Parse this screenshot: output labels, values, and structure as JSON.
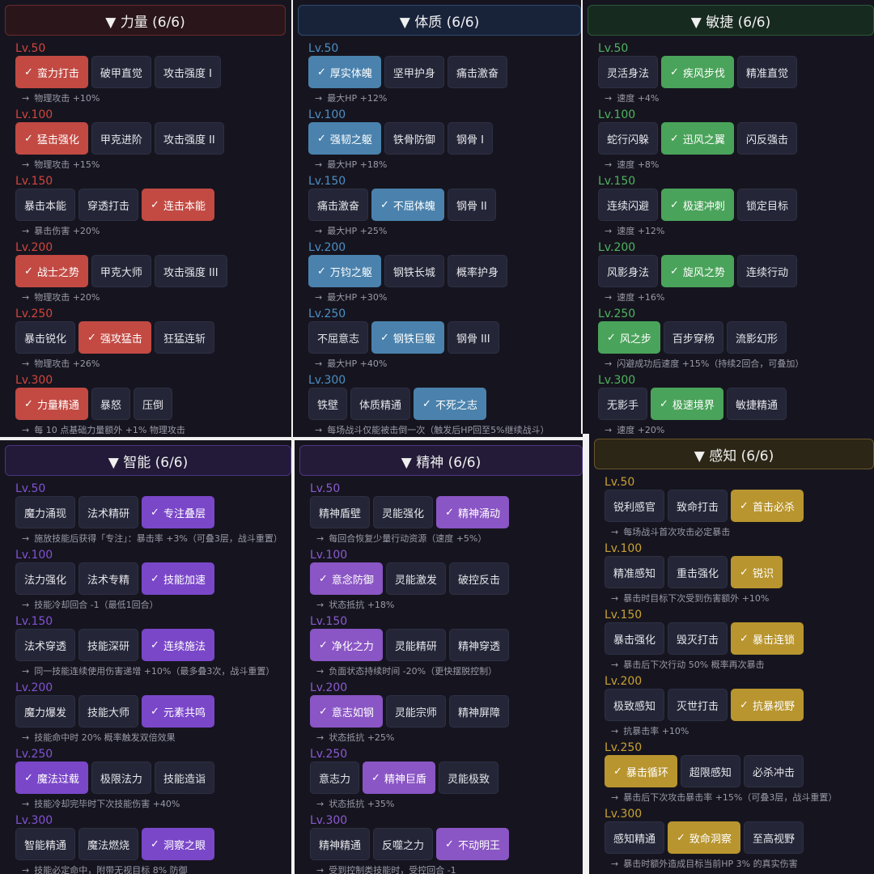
{
  "panels": [
    {
      "title": "▼ 力量 (6/6)",
      "accent": "#c24a43",
      "hdr_bg": "#2a161a",
      "hdr_border": "#6a2a2c",
      "level_color": "#d2453e",
      "levels": [
        {
          "label": "Lv.50",
          "skills": [
            "蛮力打击",
            "破甲直觉",
            "攻击强度 I"
          ],
          "selected": 0,
          "effect": "物理攻击 +10%"
        },
        {
          "label": "Lv.100",
          "skills": [
            "猛击强化",
            "甲克进阶",
            "攻击强度 II"
          ],
          "selected": 0,
          "effect": "物理攻击 +15%"
        },
        {
          "label": "Lv.150",
          "skills": [
            "暴击本能",
            "穿透打击",
            "连击本能"
          ],
          "selected": 2,
          "effect": "暴击伤害 +20%"
        },
        {
          "label": "Lv.200",
          "skills": [
            "战士之势",
            "甲克大师",
            "攻击强度 III"
          ],
          "selected": 0,
          "effect": "物理攻击 +20%"
        },
        {
          "label": "Lv.250",
          "skills": [
            "暴击锐化",
            "强攻猛击",
            "狂猛连斩"
          ],
          "selected": 1,
          "effect": "物理攻击 +26%"
        },
        {
          "label": "Lv.300",
          "skills": [
            "力量精通",
            "暴怒",
            "压倒"
          ],
          "selected": 0,
          "effect": "每 10 点基础力量额外 +1% 物理攻击"
        }
      ]
    },
    {
      "title": "▼ 体质 (6/6)",
      "accent": "#4a82ad",
      "hdr_bg": "#18233a",
      "hdr_border": "#2e4b70",
      "level_color": "#4d8fc4",
      "levels": [
        {
          "label": "Lv.50",
          "skills": [
            "厚实体魄",
            "坚甲护身",
            "痛击激奋"
          ],
          "selected": 0,
          "effect": "最大HP +12%"
        },
        {
          "label": "Lv.100",
          "skills": [
            "强韧之躯",
            "铁骨防御",
            "钢骨 I"
          ],
          "selected": 0,
          "effect": "最大HP +18%"
        },
        {
          "label": "Lv.150",
          "skills": [
            "痛击激奋",
            "不屈体魄",
            "钢骨 II"
          ],
          "selected": 1,
          "effect": "最大HP +25%"
        },
        {
          "label": "Lv.200",
          "skills": [
            "万钧之躯",
            "钢铁长城",
            "概率护身"
          ],
          "selected": 0,
          "effect": "最大HP +30%"
        },
        {
          "label": "Lv.250",
          "skills": [
            "不屈意志",
            "钢铁巨躯",
            "钢骨 III"
          ],
          "selected": 1,
          "effect": "最大HP +40%"
        },
        {
          "label": "Lv.300",
          "skills": [
            "铁壁",
            "体质精通",
            "不死之志"
          ],
          "selected": 2,
          "effect": "每场战斗仅能被击倒一次（触发后HP回至5%继续战斗）"
        }
      ]
    },
    {
      "title": "▼ 敏捷 (6/6)",
      "accent": "#4aa35a",
      "hdr_bg": "#172a20",
      "hdr_border": "#2a5a36",
      "level_color": "#4fb360",
      "levels": [
        {
          "label": "Lv.50",
          "skills": [
            "灵活身法",
            "疾风步伐",
            "精准直觉"
          ],
          "selected": 1,
          "effect": "速度 +4%"
        },
        {
          "label": "Lv.100",
          "skills": [
            "蛇行闪躲",
            "迅风之翼",
            "闪反强击"
          ],
          "selected": 1,
          "effect": "速度 +8%"
        },
        {
          "label": "Lv.150",
          "skills": [
            "连续闪避",
            "极速冲刺",
            "锁定目标"
          ],
          "selected": 1,
          "effect": "速度 +12%"
        },
        {
          "label": "Lv.200",
          "skills": [
            "风影身法",
            "旋风之势",
            "连续行动"
          ],
          "selected": 1,
          "effect": "速度 +16%"
        },
        {
          "label": "Lv.250",
          "skills": [
            "风之步",
            "百步穿杨",
            "流影幻形"
          ],
          "selected": 0,
          "effect": "闪避成功后速度 +15%（持续2回合，可叠加）"
        },
        {
          "label": "Lv.300",
          "skills": [
            "无影手",
            "极速境界",
            "敏捷精通"
          ],
          "selected": 1,
          "effect": "速度 +20%"
        }
      ]
    },
    {
      "title": "▼ 智能 (6/6)",
      "accent": "#7a47c9",
      "hdr_bg": "#221a38",
      "hdr_border": "#4a3480",
      "level_color": "#8152d4",
      "levels": [
        {
          "label": "Lv.50",
          "skills": [
            "魔力涌现",
            "法术精研",
            "专注叠层"
          ],
          "selected": 2,
          "effect": "施放技能后获得「专注」：暴击率 +3%（可叠3层，战斗重置）"
        },
        {
          "label": "Lv.100",
          "skills": [
            "法力强化",
            "法术专精",
            "技能加速"
          ],
          "selected": 2,
          "effect": "技能冷却回合 -1（最低1回合）"
        },
        {
          "label": "Lv.150",
          "skills": [
            "法术穿透",
            "技能深研",
            "连续施法"
          ],
          "selected": 2,
          "effect": "同一技能连续使用伤害递增 +10%（最多叠3次，战斗重置）"
        },
        {
          "label": "Lv.200",
          "skills": [
            "魔力爆发",
            "技能大师",
            "元素共鸣"
          ],
          "selected": 2,
          "effect": "技能命中时 20% 概率触发双倍效果"
        },
        {
          "label": "Lv.250",
          "skills": [
            "魔法过载",
            "极限法力",
            "技能造诣"
          ],
          "selected": 0,
          "effect": "技能冷却完毕时下次技能伤害 +40%"
        },
        {
          "label": "Lv.300",
          "skills": [
            "智能精通",
            "魔法燃烧",
            "洞察之眼"
          ],
          "selected": 2,
          "effect": "技能必定命中，附带无视目标 8% 防御"
        }
      ]
    },
    {
      "title": "▼ 精神 (6/6)",
      "accent": "#8a55c4",
      "hdr_bg": "#241b38",
      "hdr_border": "#4e3682",
      "level_color": "#8a5ad0",
      "levels": [
        {
          "label": "Lv.50",
          "skills": [
            "精神盾壁",
            "灵能强化",
            "精神涌动"
          ],
          "selected": 2,
          "effect": "每回合恢复少量行动资源（速度 +5%）"
        },
        {
          "label": "Lv.100",
          "skills": [
            "意念防御",
            "灵能激发",
            "破控反击"
          ],
          "selected": 0,
          "effect": "状态抵抗 +18%"
        },
        {
          "label": "Lv.150",
          "skills": [
            "净化之力",
            "灵能精研",
            "精神穿透"
          ],
          "selected": 0,
          "effect": "负面状态持续时间 -20%（更快摆脱控制）"
        },
        {
          "label": "Lv.200",
          "skills": [
            "意志如钢",
            "灵能宗师",
            "精神屏障"
          ],
          "selected": 0,
          "effect": "状态抵抗 +25%"
        },
        {
          "label": "Lv.250",
          "skills": [
            "意志力",
            "精神巨盾",
            "灵能极致"
          ],
          "selected": 1,
          "effect": "状态抵抗 +35%"
        },
        {
          "label": "Lv.300",
          "skills": [
            "精神精通",
            "反噬之力",
            "不动明王"
          ],
          "selected": 2,
          "effect": "受到控制类技能时，受控回合 -1"
        }
      ]
    },
    {
      "title": "▼ 感知 (6/6)",
      "accent": "#b8952e",
      "hdr_bg": "#2c2616",
      "hdr_border": "#6a5628",
      "level_color": "#c9a133",
      "levels": [
        {
          "label": "Lv.50",
          "skills": [
            "锐利感官",
            "致命打击",
            "首击必杀"
          ],
          "selected": 2,
          "effect": "每场战斗首次攻击必定暴击"
        },
        {
          "label": "Lv.100",
          "skills": [
            "精准感知",
            "重击强化",
            "锐识"
          ],
          "selected": 2,
          "effect": "暴击时目标下次受到伤害额外 +10%"
        },
        {
          "label": "Lv.150",
          "skills": [
            "暴击强化",
            "毁灭打击",
            "暴击连锁"
          ],
          "selected": 2,
          "effect": "暴击后下次行动 50% 概率再次暴击"
        },
        {
          "label": "Lv.200",
          "skills": [
            "极致感知",
            "灭世打击",
            "抗暴视野"
          ],
          "selected": 2,
          "effect": "抗暴击率 +10%"
        },
        {
          "label": "Lv.250",
          "skills": [
            "暴击循环",
            "超限感知",
            "必杀冲击"
          ],
          "selected": 0,
          "effect": "暴击后下次攻击暴击率 +15%（可叠3层，战斗重置）"
        },
        {
          "label": "Lv.300",
          "skills": [
            "感知精通",
            "致命洞察",
            "至高视野"
          ],
          "selected": 1,
          "effect": "暴击时额外造成目标当前HP 3% 的真实伤害"
        }
      ]
    }
  ]
}
